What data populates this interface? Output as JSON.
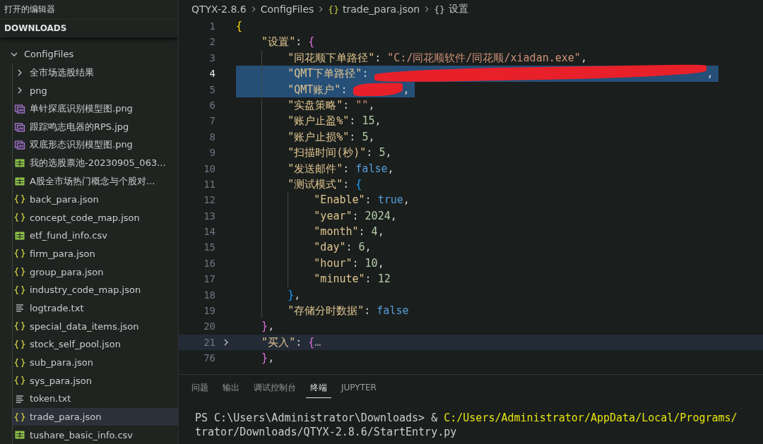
{
  "sidebar": {
    "open_editors_title": "打开的编辑器",
    "section_title": "DOWNLOADS",
    "tree": [
      {
        "name": "ConfigFiles",
        "kind": "folder",
        "expanded": true,
        "selected": false,
        "children": [
          {
            "name": "全市场选股结果",
            "kind": "folder",
            "expanded": false,
            "selected": false
          },
          {
            "name": "png",
            "kind": "folder",
            "expanded": false,
            "selected": false
          },
          {
            "name": "单针探底识别模型图.png",
            "kind": "image",
            "selected": false
          },
          {
            "name": "跟踪鸣志电器的RPS.jpg",
            "kind": "image",
            "selected": false
          },
          {
            "name": "双底形态识别模型图.png",
            "kind": "image",
            "selected": false
          },
          {
            "name": "我的选股票池-20230905_063...",
            "kind": "csv",
            "selected": false
          },
          {
            "name": "A股全市场热门概念与个股对...",
            "kind": "csv",
            "selected": false
          },
          {
            "name": "back_para.json",
            "kind": "json",
            "selected": false
          },
          {
            "name": "concept_code_map.json",
            "kind": "json",
            "selected": false
          },
          {
            "name": "etf_fund_info.csv",
            "kind": "csv",
            "selected": false
          },
          {
            "name": "firm_para.json",
            "kind": "json",
            "selected": false
          },
          {
            "name": "group_para.json",
            "kind": "json",
            "selected": false
          },
          {
            "name": "industry_code_map.json",
            "kind": "json",
            "selected": false
          },
          {
            "name": "logtrade.txt",
            "kind": "txt",
            "selected": false
          },
          {
            "name": "special_data_items.json",
            "kind": "json",
            "selected": false
          },
          {
            "name": "stock_self_pool.json",
            "kind": "json",
            "selected": false
          },
          {
            "name": "sub_para.json",
            "kind": "json",
            "selected": false
          },
          {
            "name": "sys_para.json",
            "kind": "json",
            "selected": false
          },
          {
            "name": "token.txt",
            "kind": "txt",
            "selected": false
          },
          {
            "name": "trade_para.json",
            "kind": "json",
            "selected": true
          },
          {
            "name": "tushare_basic_info.csv",
            "kind": "csv",
            "selected": false
          }
        ]
      }
    ]
  },
  "breadcrumb": [
    {
      "text": "QTYX-2.8.6"
    },
    {
      "text": "ConfigFiles"
    },
    {
      "text": "trade_para.json",
      "icon": "{}"
    },
    {
      "text": "设置",
      "icon": "{}"
    }
  ],
  "editor": {
    "lines": [
      {
        "number": "1",
        "selected": false,
        "cursor": false,
        "highlighted": false,
        "folded": false,
        "tokens": [
          {
            "kind": "brace1",
            "text": "{"
          }
        ],
        "children": [
          {
            "number": "2",
            "selected": false,
            "cursor": false,
            "highlighted": false,
            "folded": false,
            "tokens": [
              {
                "kind": "key",
                "text": "\"设置\""
              },
              {
                "kind": "punct",
                "text": ": "
              },
              {
                "kind": "brace2",
                "text": "{"
              }
            ],
            "children": [
              {
                "number": "3",
                "selected": false,
                "cursor": false,
                "highlighted": false,
                "folded": false,
                "tokens": [
                  {
                    "kind": "key",
                    "text": "\"同花顺下单路径\""
                  },
                  {
                    "kind": "punct",
                    "text": ": "
                  },
                  {
                    "kind": "string",
                    "text": "\"C:/同花顺软件/同花顺/xiadan.exe\""
                  },
                  {
                    "kind": "punct",
                    "text": ","
                  }
                ]
              },
              {
                "number": "4",
                "selected": true,
                "cursor": true,
                "highlighted": false,
                "folded": false,
                "tokens": [
                  {
                    "kind": "key",
                    "text": "\"QMT下单路径\""
                  },
                  {
                    "kind": "punct",
                    "text": ": "
                  },
                  {
                    "kind": "redacted"
                  },
                  {
                    "kind": "punct",
                    "text": ","
                  }
                ]
              },
              {
                "number": "5",
                "selected": true,
                "cursor": false,
                "highlighted": false,
                "folded": false,
                "tokens": [
                  {
                    "kind": "key",
                    "text": "\"QMT账户\""
                  },
                  {
                    "kind": "punct",
                    "text": ": "
                  },
                  {
                    "kind": "redacted"
                  },
                  {
                    "kind": "punct",
                    "text": ","
                  }
                ]
              },
              {
                "number": "6",
                "selected": false,
                "cursor": false,
                "highlighted": false,
                "folded": false,
                "tokens": [
                  {
                    "kind": "key",
                    "text": "\"实盘策略\""
                  },
                  {
                    "kind": "punct",
                    "text": ": "
                  },
                  {
                    "kind": "string",
                    "text": "\"\""
                  },
                  {
                    "kind": "punct",
                    "text": ","
                  }
                ]
              },
              {
                "number": "7",
                "selected": false,
                "cursor": false,
                "highlighted": false,
                "folded": false,
                "tokens": [
                  {
                    "kind": "key",
                    "text": "\"账户止盈%\""
                  },
                  {
                    "kind": "punct",
                    "text": ": "
                  },
                  {
                    "kind": "number",
                    "text": "15"
                  },
                  {
                    "kind": "punct",
                    "text": ","
                  }
                ]
              },
              {
                "number": "8",
                "selected": false,
                "cursor": false,
                "highlighted": false,
                "folded": false,
                "tokens": [
                  {
                    "kind": "key",
                    "text": "\"账户止损%\""
                  },
                  {
                    "kind": "punct",
                    "text": ": "
                  },
                  {
                    "kind": "number",
                    "text": "5"
                  },
                  {
                    "kind": "punct",
                    "text": ","
                  }
                ]
              },
              {
                "number": "9",
                "selected": false,
                "cursor": false,
                "highlighted": false,
                "folded": false,
                "tokens": [
                  {
                    "kind": "key",
                    "text": "\"扫描时间(秒)\""
                  },
                  {
                    "kind": "punct",
                    "text": ": "
                  },
                  {
                    "kind": "number",
                    "text": "5"
                  },
                  {
                    "kind": "punct",
                    "text": ","
                  }
                ]
              },
              {
                "number": "10",
                "selected": false,
                "cursor": false,
                "highlighted": false,
                "folded": false,
                "tokens": [
                  {
                    "kind": "key",
                    "text": "\"发送邮件\""
                  },
                  {
                    "kind": "punct",
                    "text": ": "
                  },
                  {
                    "kind": "bool",
                    "text": "false"
                  },
                  {
                    "kind": "punct",
                    "text": ","
                  }
                ]
              },
              {
                "number": "11",
                "selected": false,
                "cursor": false,
                "highlighted": false,
                "folded": false,
                "tokens": [
                  {
                    "kind": "key",
                    "text": "\"测试模式\""
                  },
                  {
                    "kind": "punct",
                    "text": ": "
                  },
                  {
                    "kind": "brace3",
                    "text": "{"
                  }
                ],
                "children": [
                  {
                    "number": "12",
                    "selected": false,
                    "cursor": false,
                    "highlighted": false,
                    "folded": false,
                    "tokens": [
                      {
                        "kind": "key",
                        "text": "\"Enable\""
                      },
                      {
                        "kind": "punct",
                        "text": ": "
                      },
                      {
                        "kind": "bool",
                        "text": "true"
                      },
                      {
                        "kind": "punct",
                        "text": ","
                      }
                    ]
                  },
                  {
                    "number": "13",
                    "selected": false,
                    "cursor": false,
                    "highlighted": false,
                    "folded": false,
                    "tokens": [
                      {
                        "kind": "key",
                        "text": "\"year\""
                      },
                      {
                        "kind": "punct",
                        "text": ": "
                      },
                      {
                        "kind": "number",
                        "text": "2024"
                      },
                      {
                        "kind": "punct",
                        "text": ","
                      }
                    ]
                  },
                  {
                    "number": "14",
                    "selected": false,
                    "cursor": false,
                    "highlighted": false,
                    "folded": false,
                    "tokens": [
                      {
                        "kind": "key",
                        "text": "\"month\""
                      },
                      {
                        "kind": "punct",
                        "text": ": "
                      },
                      {
                        "kind": "number",
                        "text": "4"
                      },
                      {
                        "kind": "punct",
                        "text": ","
                      }
                    ]
                  },
                  {
                    "number": "15",
                    "selected": false,
                    "cursor": false,
                    "highlighted": false,
                    "folded": false,
                    "tokens": [
                      {
                        "kind": "key",
                        "text": "\"day\""
                      },
                      {
                        "kind": "punct",
                        "text": ": "
                      },
                      {
                        "kind": "number",
                        "text": "6"
                      },
                      {
                        "kind": "punct",
                        "text": ","
                      }
                    ]
                  },
                  {
                    "number": "16",
                    "selected": false,
                    "cursor": false,
                    "highlighted": false,
                    "folded": false,
                    "tokens": [
                      {
                        "kind": "key",
                        "text": "\"hour\""
                      },
                      {
                        "kind": "punct",
                        "text": ": "
                      },
                      {
                        "kind": "number",
                        "text": "10"
                      },
                      {
                        "kind": "punct",
                        "text": ","
                      }
                    ]
                  },
                  {
                    "number": "17",
                    "selected": false,
                    "cursor": false,
                    "highlighted": false,
                    "folded": false,
                    "tokens": [
                      {
                        "kind": "key",
                        "text": "\"minute\""
                      },
                      {
                        "kind": "punct",
                        "text": ": "
                      },
                      {
                        "kind": "number",
                        "text": "12"
                      }
                    ]
                  }
                ]
              },
              {
                "number": "18",
                "selected": false,
                "cursor": false,
                "highlighted": false,
                "folded": false,
                "tokens": [
                  {
                    "kind": "brace3",
                    "text": "}"
                  },
                  {
                    "kind": "punct",
                    "text": ","
                  }
                ]
              },
              {
                "number": "19",
                "selected": false,
                "cursor": false,
                "highlighted": false,
                "folded": false,
                "tokens": [
                  {
                    "kind": "key",
                    "text": "\"存储分时数据\""
                  },
                  {
                    "kind": "punct",
                    "text": ": "
                  },
                  {
                    "kind": "bool",
                    "text": "false"
                  }
                ]
              }
            ]
          },
          {
            "number": "20",
            "selected": false,
            "cursor": false,
            "highlighted": false,
            "folded": false,
            "tokens": [
              {
                "kind": "brace2",
                "text": "}"
              },
              {
                "kind": "punct",
                "text": ","
              }
            ]
          },
          {
            "number": "21",
            "selected": false,
            "cursor": false,
            "highlighted": true,
            "folded": true,
            "tokens": [
              {
                "kind": "key",
                "text": "\"买入\""
              },
              {
                "kind": "punct",
                "text": ": "
              },
              {
                "kind": "brace2",
                "text": "{"
              },
              {
                "kind": "ellipsis",
                "text": "…"
              }
            ]
          },
          {
            "number": "76",
            "selected": false,
            "cursor": false,
            "highlighted": false,
            "folded": false,
            "tokens": [
              {
                "kind": "brace2",
                "text": "}"
              },
              {
                "kind": "punct",
                "text": ","
              }
            ]
          }
        ]
      }
    ]
  },
  "panel": {
    "tabs": [
      {
        "label": "问题",
        "selected": false
      },
      {
        "label": "输出",
        "selected": false
      },
      {
        "label": "调试控制台",
        "selected": false
      },
      {
        "label": "终端",
        "selected": true
      },
      {
        "label": "JUPYTER",
        "selected": false
      }
    ],
    "terminal": [
      {
        "prompt": "PS C:\\Users\\Administrator\\Downloads> & ",
        "command": "C:/Users/Administrator/AppData/Local/Programs/"
      },
      {
        "prompt": "trator/Downloads/QTYX-2.8.6/StartEntry.py"
      }
    ]
  }
}
